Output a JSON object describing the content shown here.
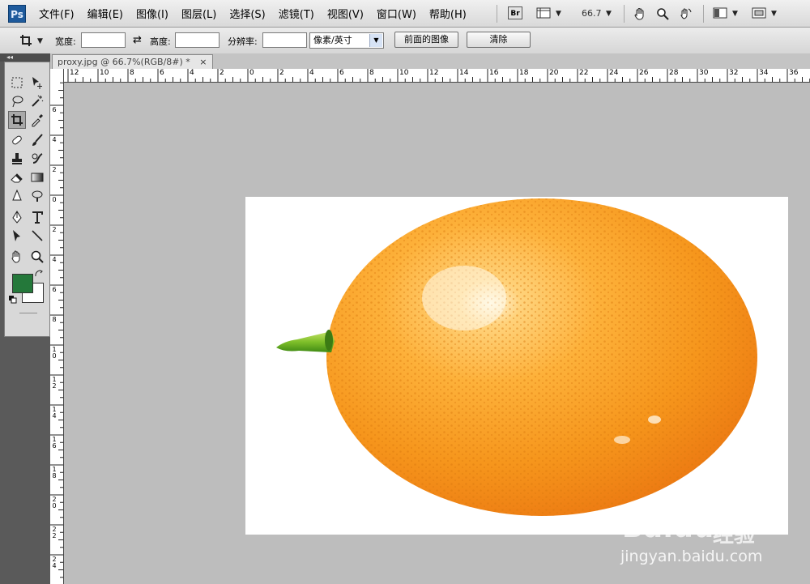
{
  "app": {
    "logo_text": "Ps"
  },
  "menu": [
    "文件(F)",
    "编辑(E)",
    "图像(I)",
    "图层(L)",
    "选择(S)",
    "滤镜(T)",
    "视图(V)",
    "窗口(W)",
    "帮助(H)"
  ],
  "appbar": {
    "bridge_label": "Br",
    "zoom": "66.7",
    "arrow": "▼"
  },
  "options": {
    "width_label": "宽度:",
    "height_label": "高度:",
    "resolution_label": "分辨率:",
    "unit_select": "像素/英寸",
    "front_image_button": "前面的图像",
    "clear_button": "清除",
    "swap_glyph": "⇄"
  },
  "panel": {
    "collapse": "◂◂"
  },
  "document": {
    "tab_title": "proxy.jpg @ 66.7%(RGB/8#) *",
    "close": "×"
  },
  "colors": {
    "foreground": "#24783a",
    "background": "#ffffff"
  },
  "ruler": {
    "h_labels": [
      "12",
      "10",
      "8",
      "6",
      "4",
      "2",
      "0",
      "2",
      "4",
      "6",
      "8",
      "10",
      "12",
      "14",
      "16",
      "18",
      "20",
      "22",
      "24",
      "26",
      "28",
      "30",
      "32",
      "34",
      "36"
    ],
    "v_labels": [
      "6",
      "4",
      "2",
      "0",
      "2",
      "4",
      "6",
      "8",
      "10",
      "12",
      "14",
      "16",
      "18",
      "20",
      "22",
      "24"
    ]
  },
  "watermark": {
    "brand": "Baidu",
    "cn": "经验",
    "url": "jingyan.baidu.com"
  }
}
